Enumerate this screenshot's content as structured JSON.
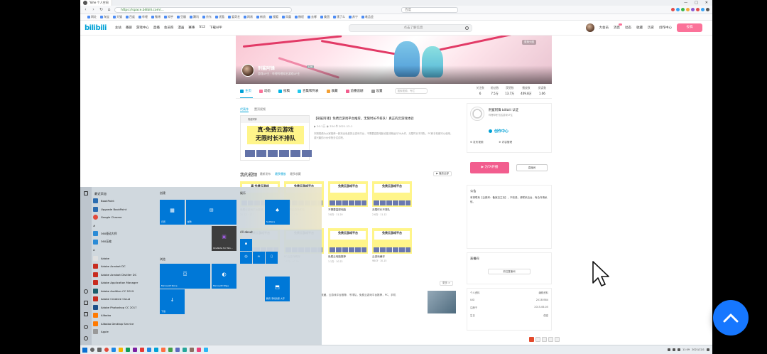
{
  "browser": {
    "tab_title": "Yohe  个人空间",
    "url": "https://space.bilibili.com/...",
    "search_placeholder": "百度",
    "window_controls": [
      "—",
      "□",
      "✕"
    ],
    "bookmarks": [
      "网址",
      "淘宝",
      "天猫",
      "百度",
      "哔哩",
      "微博",
      "知乎",
      "豆瓣",
      "腾讯",
      "京东",
      "优酷",
      "爱奇艺",
      "网易",
      "新浪",
      "搜狐",
      "凤凰",
      "携程",
      "去哪",
      "美团",
      "饿了么",
      "苏宁",
      "唯品会"
    ]
  },
  "bili_header": {
    "logo": "bilibili",
    "nav": [
      "主站",
      "番剧",
      "游戏中心",
      "直播",
      "会员购",
      "漫画",
      "赛事",
      "S12",
      "下载APP"
    ],
    "search_placeholder": "点击了解信息",
    "right": [
      "大会员",
      "消息",
      "动态",
      "收藏",
      "历史",
      "创作中心"
    ],
    "upload": "投稿"
  },
  "banner": {
    "up_name": "刑鲨阿锋",
    "level": "LV6",
    "sign": "游戏UP主 · 哔哩哔哩知名游戏UP主",
    "chip": "更换头图"
  },
  "space_nav": {
    "items": [
      {
        "label": "主页",
        "color": "#00a1d6"
      },
      {
        "label": "动态",
        "color": "#fb7299"
      },
      {
        "label": "投稿",
        "color": "#00b5e5"
      },
      {
        "label": "合集和列表",
        "color": "#23c9ed"
      },
      {
        "label": "收藏",
        "color": "#f3a034"
      },
      {
        "label": "追番追剧",
        "color": "#f25d8e"
      },
      {
        "label": "设置",
        "color": "#999999"
      }
    ],
    "search_placeholder": "搜索视频、专栏",
    "stats": [
      {
        "label": "关注数",
        "value": "6"
      },
      {
        "label": "粉丝数",
        "value": "7.5万"
      },
      {
        "label": "获赞数",
        "value": "13.7万"
      },
      {
        "label": "播放数",
        "value": "409.8万"
      },
      {
        "label": "阅读数",
        "value": "1.06"
      }
    ]
  },
  "feature": {
    "tabs": [
      "代表作",
      "置顶视频"
    ],
    "head": "刑鲨阿锋",
    "headline_line1": "真·免费云游戏",
    "headline_line2": "无限时长不排队",
    "title": "【刑鲨阿锋】免费云游戏平台推荐，无限时长不排队！真正的云游戏体验",
    "meta": "▶ 20.1万   ◉ 334   ⏱ 2021-12-1",
    "desc": "本期视频为大家推荐一款完全免费的云游戏平台，不需要高配电脑也能流畅运行3A大作，无限时长不排队，PC和手机都可以使用，感兴趣的小伙伴快去试试吧。"
  },
  "videos": {
    "title": "我的视频",
    "tabs": [
      "最新发布",
      "最多播放",
      "最多收藏"
    ],
    "play_all": "▶ 播放全部",
    "more": "更多 >",
    "items": [
      {
        "band": "真·免费云游戏",
        "title": "免费云游戏平台推荐",
        "meta": "20.1万 · 12-1"
      },
      {
        "band": "免费云游戏平台",
        "title": "真正的云游戏体验",
        "meta": "5.1万 · 11-28"
      },
      {
        "band": "免费云游戏平台",
        "title": "不需要高配电脑",
        "meta": "3.8万 · 11-20"
      },
      {
        "band": "免费云游戏平台",
        "title": "无限时长不排队",
        "meta": "2.6万 · 11-12"
      },
      {
        "band": "免费云游戏平台",
        "title": "手机也能玩3A",
        "meta": "1.9万 · 11-05"
      },
      {
        "band": "免费云游戏平台",
        "title": "PC云游戏教程",
        "meta": "1.5万 · 10-30"
      },
      {
        "band": "免费云游戏平台",
        "title": "免费云电脑推荐",
        "meta": "1.1万 · 10-22"
      },
      {
        "band": "免费云游戏平台",
        "title": "云游戏横评",
        "meta": "9843 · 10-15"
      }
    ],
    "bottom_desc": "收藏，云游戏平台推荐，不排队，免费云游戏平台推荐，PC、手机"
  },
  "right": {
    "auth_title": "刑鲨阿锋  bilibili 认证",
    "auth_sub": "哔哩哔哩 知名游戏UP主",
    "creator": "创作中心",
    "actions": [
      "⊕ 发布视频",
      "⊕ 内容管理"
    ],
    "live_btn": "▶ 为TA开播",
    "live_tag": "直播间",
    "notice_title": "公告",
    "notice_text": "有事联系【企鹅号：备案见主页】，不收钱，请联系后台，有合作请私信。",
    "tags_title": "直播间",
    "tags_btn": "前往直播间",
    "profile_title": "个人资料",
    "profile_edit": "编辑资料",
    "profile_rows": [
      [
        "UID",
        "20130584"
      ],
      [
        "注册于",
        "2015-06-05"
      ],
      [
        "生日",
        "保密"
      ]
    ]
  },
  "startmenu": {
    "recent_head": "最近添加",
    "items": [
      {
        "label": "BookPoint",
        "color": "#2b6cb0"
      },
      {
        "label": "Upgrade BookPoint",
        "color": "#2b6cb0"
      },
      {
        "label": "Google Chrome",
        "color": "#e24a3b"
      },
      {
        "label": "#",
        "color": "transparent"
      },
      {
        "label": "360驱动大师",
        "color": "#2b8bd6"
      },
      {
        "label": "360压缩",
        "color": "#2b8bd6"
      },
      {
        "label": "A",
        "color": "transparent"
      },
      {
        "label": "Adobe",
        "color": "#e0e0e0"
      },
      {
        "label": "Adobe Acrobat DC",
        "color": "#c82c1f"
      },
      {
        "label": "Adobe Acrobat Distiller DC",
        "color": "#c82c1f"
      },
      {
        "label": "Adobe Application Manager",
        "color": "#c82c1f"
      },
      {
        "label": "Adobe Audition CC 2019",
        "color": "#1b5e6b"
      },
      {
        "label": "Adobe Creative Cloud",
        "color": "#c82c1f"
      },
      {
        "label": "Adobe Photoshop CC 2017",
        "color": "#1b4f8a"
      },
      {
        "label": "Alibaba",
        "color": "#ff7a00"
      },
      {
        "label": "Alibaba Desktop Service",
        "color": "#ff7a00"
      },
      {
        "label": "Apple",
        "color": "#999999"
      }
    ],
    "group_create": "创建",
    "group_browse": "浏览",
    "group_play": "娱乐",
    "group_all": "All about",
    "tiles": [
      {
        "label": "日历"
      },
      {
        "label": "邮件"
      },
      {
        "label": "Microsoft Store"
      },
      {
        "label": "Microsoft Edge"
      },
      {
        "label": "OneNote for Win..."
      },
      {
        "label": "Solitaire"
      },
      {
        "label": "腾讯 手机管家 大字"
      },
      {
        "label": "下载"
      }
    ]
  },
  "taskbar": {
    "clock": "11:09",
    "date": "2021/12/1"
  },
  "fab_label": "∧"
}
